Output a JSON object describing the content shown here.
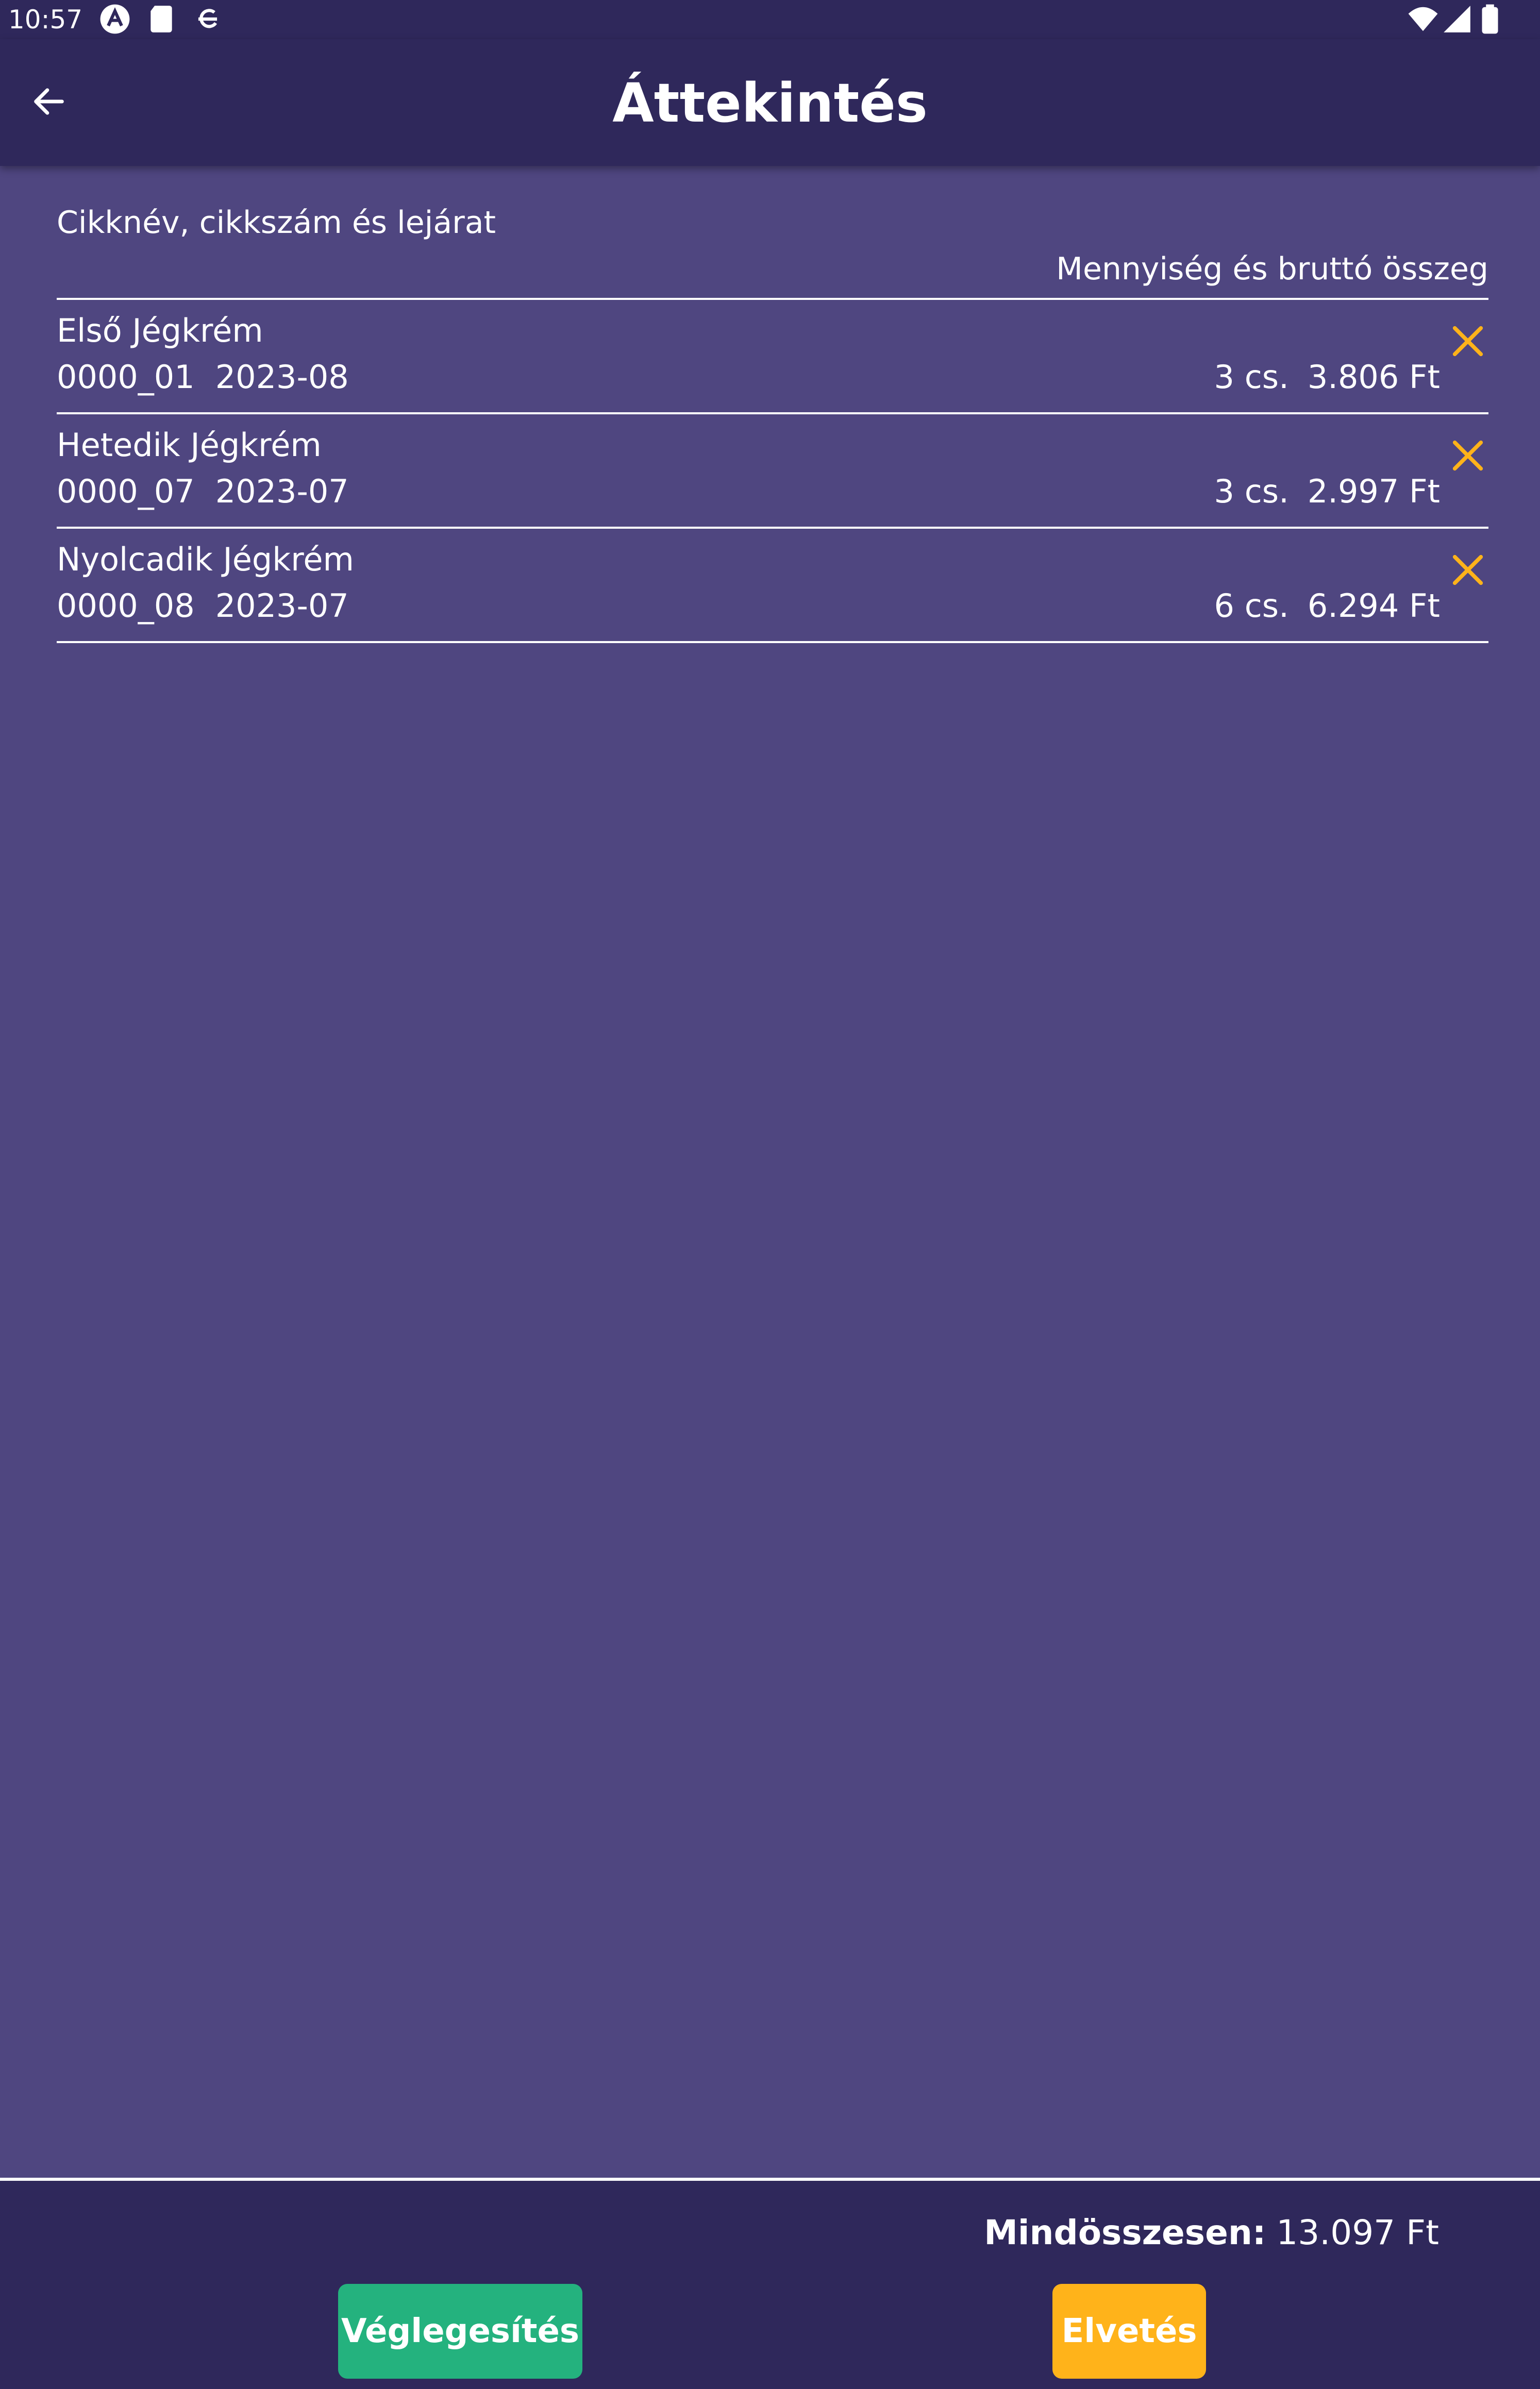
{
  "status_bar": {
    "time": "10:57"
  },
  "app_bar": {
    "title": "Áttekintés"
  },
  "list_header": {
    "left": "Cikknév, cikkszám és lejárat",
    "right": "Mennyiség és bruttó összeg"
  },
  "items": [
    {
      "name": "Első Jégkrém",
      "sku": "0000_01",
      "expiry": "2023-08",
      "quantity": "3 cs.",
      "amount": "3.806 Ft"
    },
    {
      "name": "Hetedik Jégkrém",
      "sku": "0000_07",
      "expiry": "2023-07",
      "quantity": "3 cs.",
      "amount": "2.997 Ft"
    },
    {
      "name": "Nyolcadik Jégkrém",
      "sku": "0000_08",
      "expiry": "2023-07",
      "quantity": "6 cs.",
      "amount": "6.294 Ft"
    }
  ],
  "footer": {
    "total_label": "Mindösszesen:",
    "total_value": "13.097 Ft",
    "finalize_label": "Véglegesítés",
    "discard_label": "Elvetés"
  },
  "colors": {
    "background": "#4f4680",
    "bar": "#2f285b",
    "remove_icon": "#ffb31a",
    "finalize_button": "#24b27e",
    "discard_button": "#ffb31a"
  },
  "icons": {
    "back": "arrow-left-icon",
    "remove": "close-icon"
  }
}
